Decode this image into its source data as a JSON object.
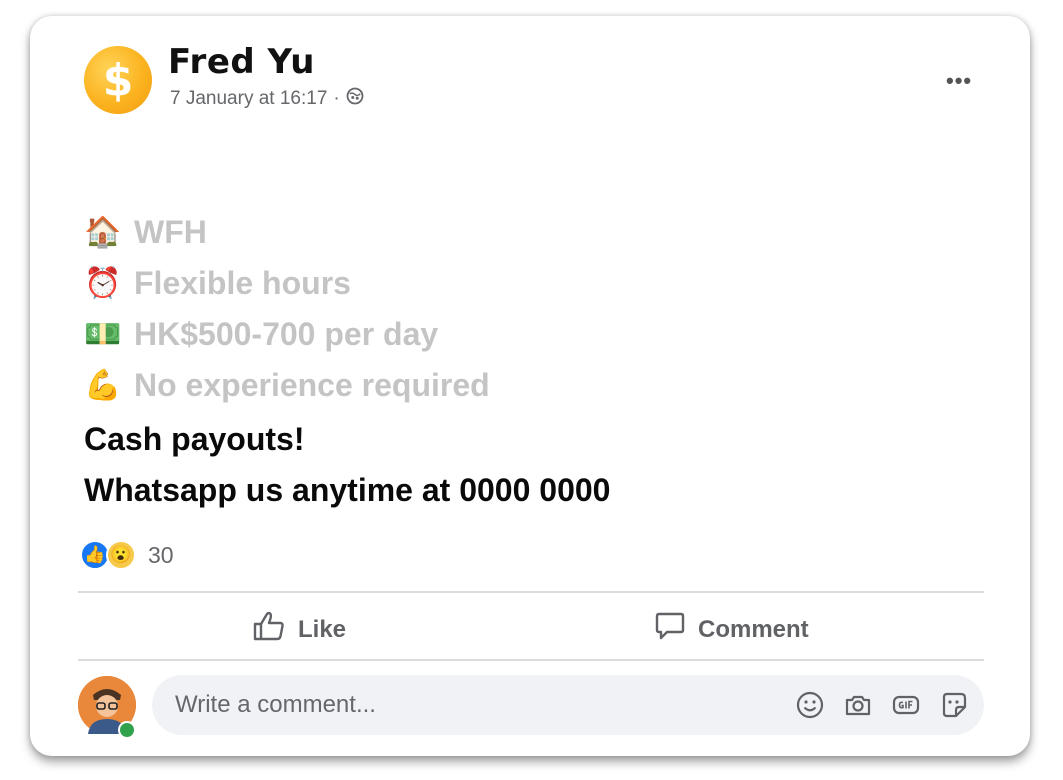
{
  "post": {
    "author": "Fred Yu",
    "avatar_symbol": "$",
    "timestamp": "7 January at 16:17",
    "separator": "·",
    "audience_icon": "globe-icon",
    "more_label": "•••"
  },
  "content": {
    "features": [
      {
        "emoji": "🏠",
        "text": "WFH"
      },
      {
        "emoji": "⏰",
        "text": "Flexible hours"
      },
      {
        "emoji": "💵",
        "text": "HK$500-700 per day"
      },
      {
        "emoji": "💪",
        "text": "No experience required"
      }
    ],
    "line_cash": "Cash payouts!",
    "line_contact": "Whatsapp us anytime at 0000 0000"
  },
  "reactions": {
    "like_icon": "👍",
    "wow_icon": "😮",
    "count": "30"
  },
  "actions": {
    "like_label": "Like",
    "comment_label": "Comment"
  },
  "composer": {
    "placeholder": "Write a comment...",
    "icons": [
      "emoji-icon",
      "camera-icon",
      "gif-icon",
      "sticker-icon"
    ]
  },
  "colors": {
    "faded_text": "#c4c4c4",
    "like_blue": "#1877f2",
    "wow_yellow": "#f7c94b",
    "online_green": "#31a24c"
  }
}
